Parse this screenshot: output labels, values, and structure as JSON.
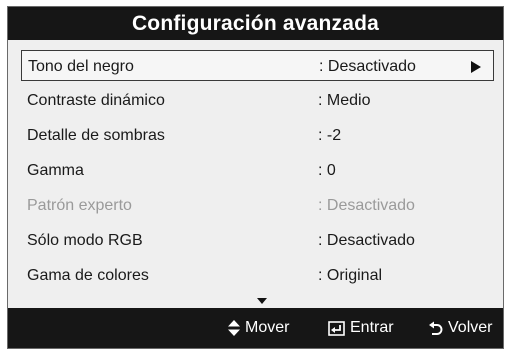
{
  "title": "Configuración avanzada",
  "items": [
    {
      "label": "Tono del negro",
      "value": ": Desactivado",
      "selected": true,
      "disabled": false
    },
    {
      "label": "Contraste dinámico",
      "value": ": Medio",
      "selected": false,
      "disabled": false
    },
    {
      "label": "Detalle de sombras",
      "value": ": -2",
      "selected": false,
      "disabled": false
    },
    {
      "label": "Gamma",
      "value": ": 0",
      "selected": false,
      "disabled": false
    },
    {
      "label": "Patrón experto",
      "value": ": Desactivado",
      "selected": false,
      "disabled": true
    },
    {
      "label": "Sólo modo RGB",
      "value": ": Desactivado",
      "selected": false,
      "disabled": false
    },
    {
      "label": "Gama de colores",
      "value": ": Original",
      "selected": false,
      "disabled": false
    }
  ],
  "footer": {
    "move_label": "Mover",
    "enter_label": "Entrar",
    "return_label": "Volver"
  },
  "icons": {
    "move": "up-down-arrows-icon",
    "enter": "enter-icon",
    "return": "return-icon",
    "submenu": "triangle-right-icon",
    "scroll": "triangle-down-icon"
  },
  "colors": {
    "bar": "#161616",
    "panel": "#efefef",
    "disabled_text": "#9a9a9a"
  }
}
